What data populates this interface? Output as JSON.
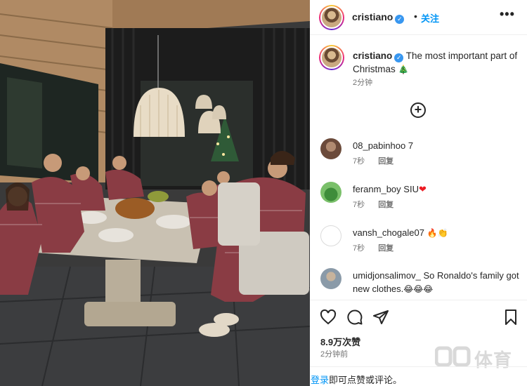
{
  "post_image": {
    "alt": ""
  },
  "header": {
    "username": "cristiano",
    "follow_label": "关注",
    "separator": "•",
    "more_label": "•••"
  },
  "caption": {
    "username": "cristiano",
    "text": "The most important part of Christmas",
    "emoji": "🎄",
    "time": "2分钟"
  },
  "comments": [
    {
      "username": "08_pabinhoo",
      "text": "7",
      "time": "7秒",
      "reply_label": "回复",
      "avatar_color": "#6b4a3a"
    },
    {
      "username": "feranm_boy",
      "text": "SIU",
      "emoji": "❤",
      "time": "7秒",
      "reply_label": "回复",
      "avatar_color": "#3e8d3a"
    },
    {
      "username": "vansh_chogale07",
      "text": "",
      "emoji": "🔥👏",
      "time": "7秒",
      "reply_label": "回复",
      "avatar_color": "#ffffff"
    },
    {
      "username": "umidjonsalimov_",
      "text": "So Ronaldo's family got new clothes.",
      "emoji": "😂😂😂",
      "avatar_color": "#8a9aa8"
    }
  ],
  "actions": {
    "likes": "8.9万次赞",
    "time": "2分钟前"
  },
  "login_bar": {
    "link": "登录",
    "text": "即可点赞或评论。"
  },
  "watermark": {
    "text": "体育"
  },
  "icons": {
    "verified": "verified-badge-icon",
    "more": "more-options-icon",
    "load_more": "plus-circle-icon",
    "like": "heart-icon",
    "comment": "comment-bubble-icon",
    "share": "paper-plane-icon",
    "save": "bookmark-icon"
  },
  "colors": {
    "accent": "#0095f6",
    "verified": "#3897f0",
    "secondary_text": "#737373"
  }
}
